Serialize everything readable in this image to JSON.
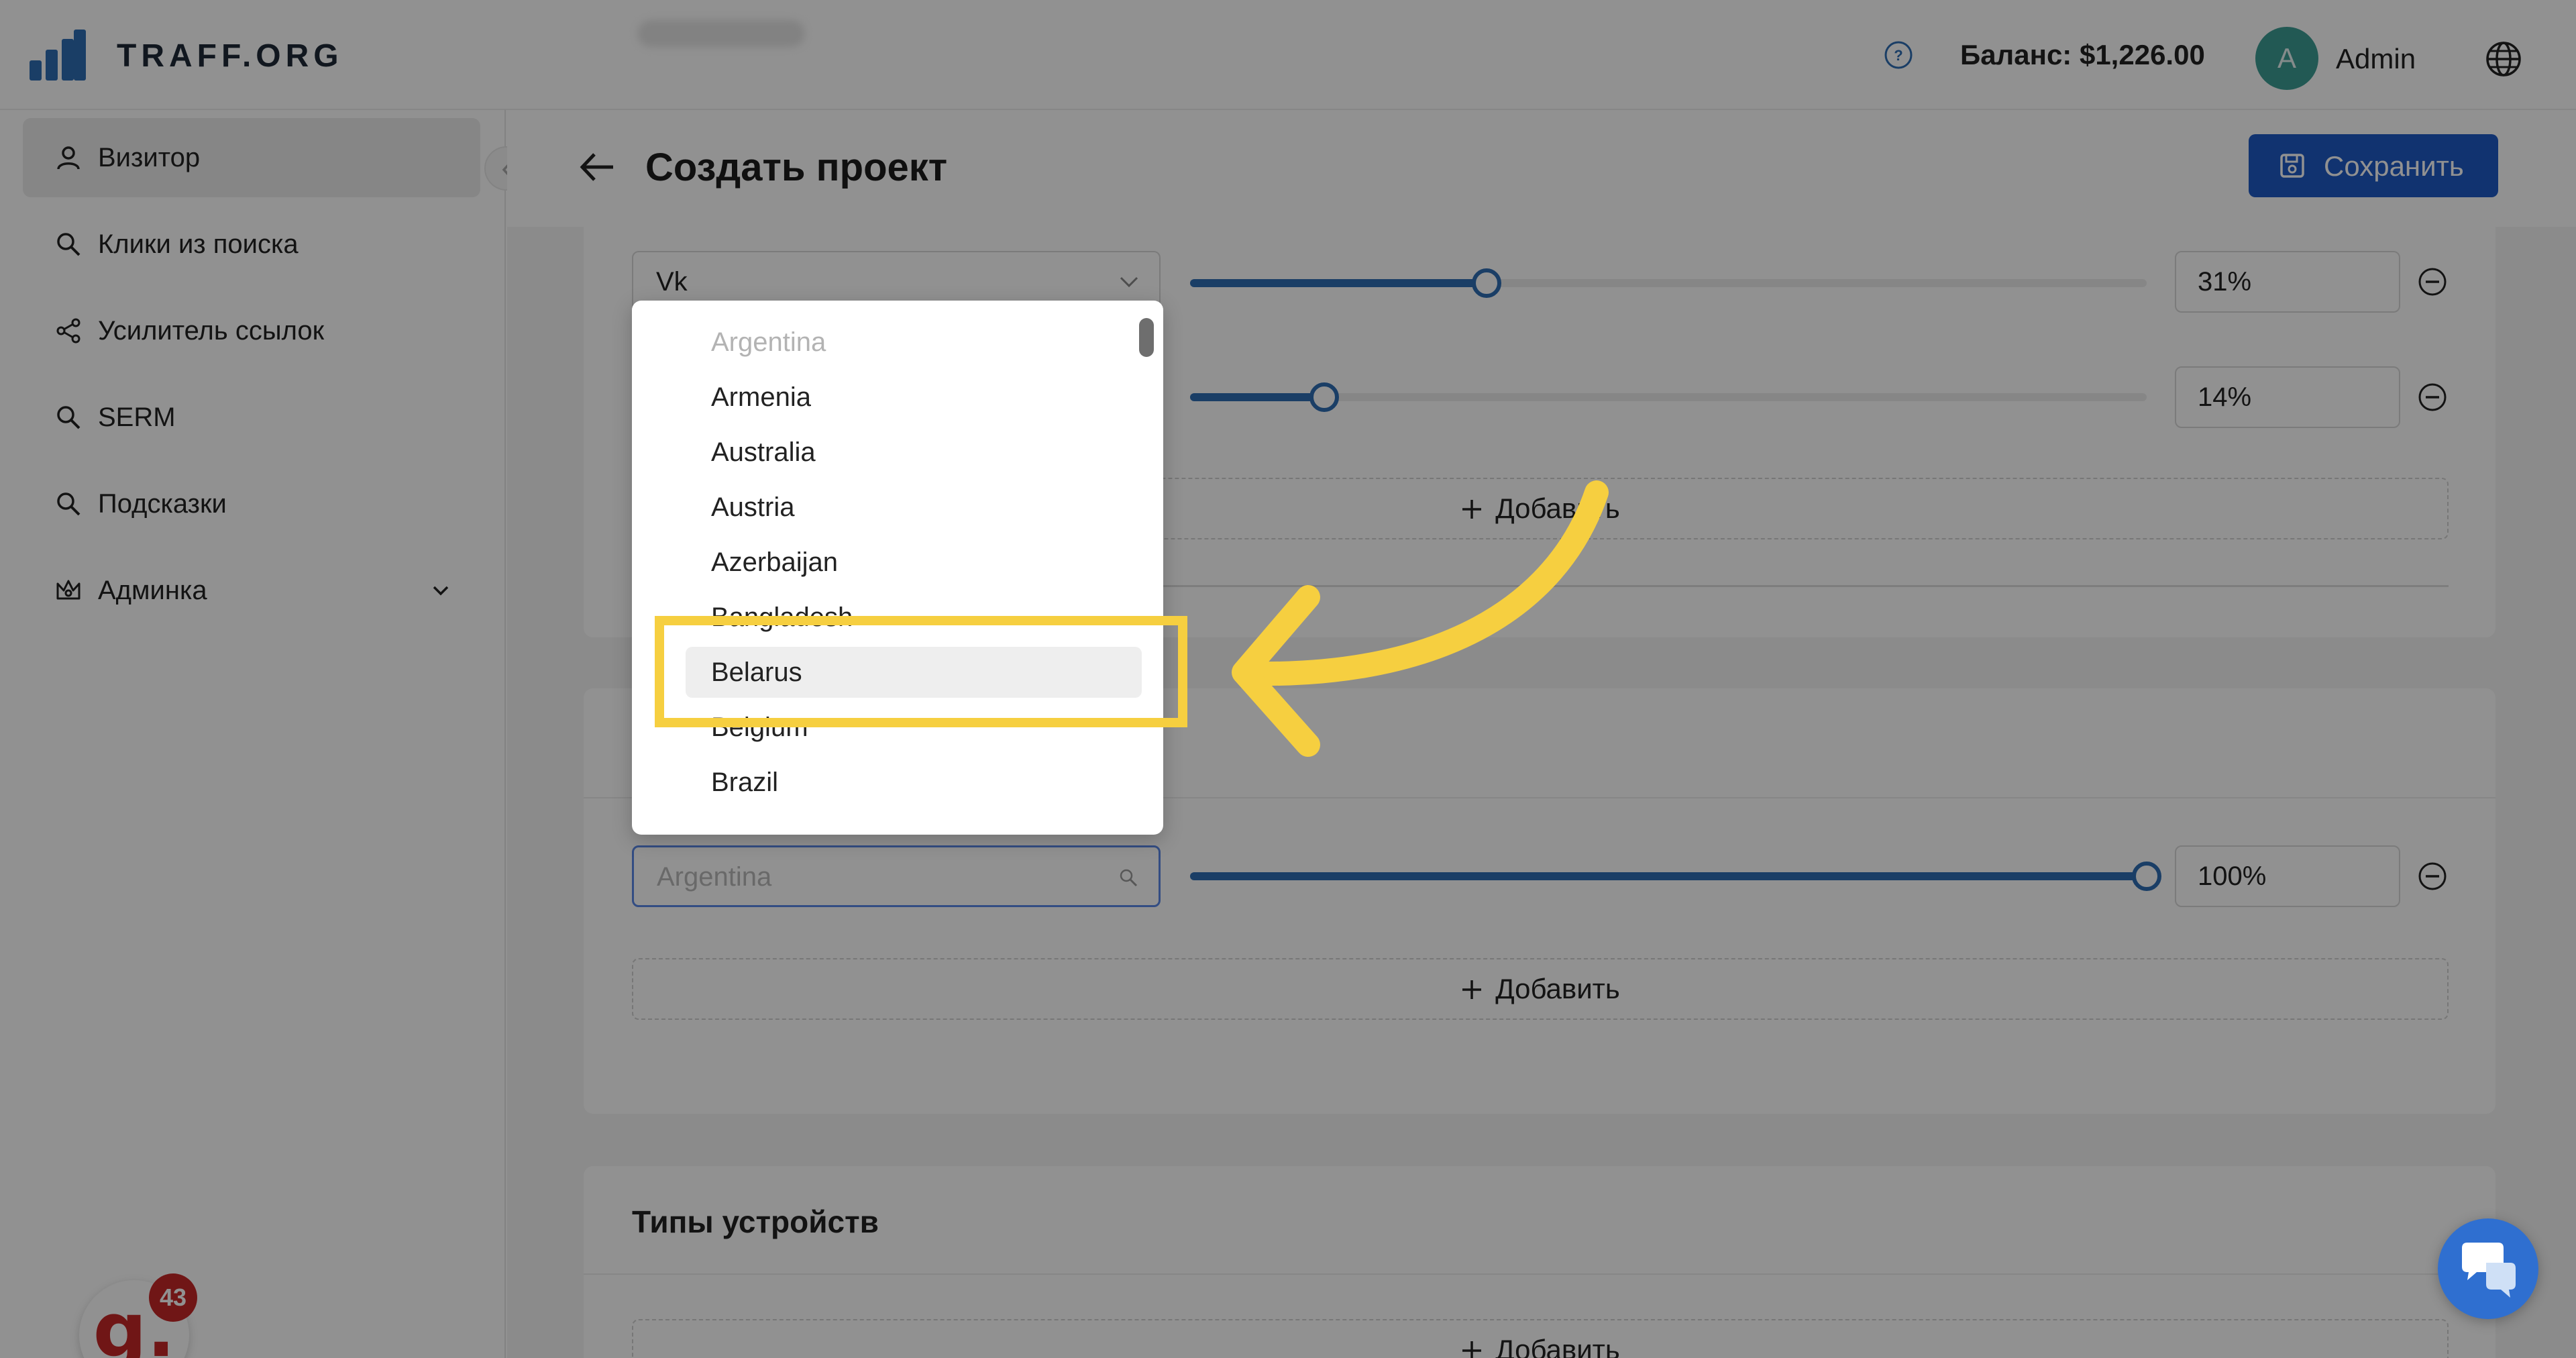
{
  "header": {
    "logo_text": "TRAFF.ORG",
    "balance": "Баланс: $1,226.00",
    "user": {
      "avatar_letter": "A",
      "name": "Admin",
      "avatar_color": "#3c9d94"
    }
  },
  "sidebar": {
    "items": [
      {
        "label": "Визитор",
        "icon": "user-icon",
        "active": true
      },
      {
        "label": "Клики из поиска",
        "icon": "search-icon"
      },
      {
        "label": "Усилитель ссылок",
        "icon": "share-icon"
      },
      {
        "label": "SERM",
        "icon": "search-icon"
      },
      {
        "label": "Подсказки",
        "icon": "search-icon"
      },
      {
        "label": "Админка",
        "icon": "crown-icon",
        "expandable": true
      }
    ],
    "notification_badge": {
      "letter": "g.",
      "count": "43"
    }
  },
  "page": {
    "title": "Создать проект",
    "save_label": "Сохранить"
  },
  "sources": {
    "rows": [
      {
        "select_value": "Vk",
        "percent": "31%",
        "slider_value": 31
      },
      {
        "select_value": "",
        "percent": "14%",
        "slider_value": 14
      }
    ],
    "add_label": "Добавить"
  },
  "geo": {
    "country_search": {
      "placeholder": "Argentina"
    },
    "percent": "100%",
    "slider_value": 100,
    "add_label": "Добавить"
  },
  "country_dropdown": {
    "options": [
      "Argentina",
      "Armenia",
      "Australia",
      "Austria",
      "Azerbaijan",
      "Bangladesh",
      "Belarus",
      "Belgium",
      "Brazil"
    ],
    "selected": "Belarus",
    "muted": "Argentina"
  },
  "devices": {
    "title": "Типы устройств",
    "add_label": "Добавить"
  },
  "colors": {
    "primary": "#1f5bc6",
    "slider": "#2f6db3",
    "highlight": "#f6cf40",
    "badge": "#c62828"
  }
}
